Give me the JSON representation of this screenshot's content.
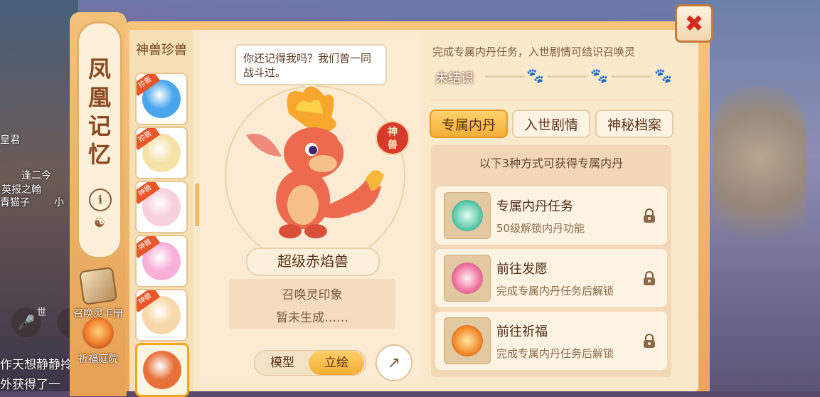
{
  "background": {
    "chat_lines": [
      "作天想静静拎",
      "外获得了一"
    ],
    "names": [
      "皇君",
      "逢二今",
      "英报之翰",
      "青猫子",
      "小"
    ],
    "world_label": "世"
  },
  "sidebar": {
    "title": "凤凰记忆",
    "info_icon": "i",
    "features": [
      {
        "label": "召唤灵卡册",
        "icon": "card-album-icon"
      },
      {
        "label": "祈福庭院",
        "icon": "lantern-icon"
      }
    ]
  },
  "list": {
    "title": "神兽珍兽",
    "items": [
      {
        "tag": "珍兽",
        "color": "#4aa6ec"
      },
      {
        "tag": "珍兽",
        "color": "#f6e2a8"
      },
      {
        "tag": "神兽",
        "color": "#f6d0dc"
      },
      {
        "tag": "神兽",
        "color": "#f8b0d8"
      },
      {
        "tag": "神兽",
        "color": "#f8d8a8"
      },
      {
        "tag": "",
        "color": "#e8703a"
      }
    ]
  },
  "display": {
    "speech": "你还记得我吗？我们曾一同战斗过。",
    "seal_text": "神兽",
    "pet_name": "超级赤焰兽",
    "imprint_title": "召唤灵印象",
    "imprint_status": "暂未生成……",
    "view_options": [
      "模型",
      "立绘"
    ],
    "active_view": "立绘"
  },
  "bond": {
    "hint": "完成专属内丹任务，入世剧情可结识召唤灵",
    "status": "未结识"
  },
  "tabs": [
    {
      "label": "专属内丹",
      "active": true
    },
    {
      "label": "入世剧情",
      "active": false
    },
    {
      "label": "神秘档案",
      "active": false
    }
  ],
  "methods": {
    "title": "以下3种方式可获得专属内丹",
    "items": [
      {
        "title": "专属内丹任务",
        "desc": "50级解锁内丹功能",
        "icon": "jade-orb-icon"
      },
      {
        "title": "前往发愿",
        "desc": "完成专属内丹任务后解锁",
        "icon": "peony-icon"
      },
      {
        "title": "前往祈福",
        "desc": "完成专属内丹任务后解锁",
        "icon": "lantern-icon"
      }
    ]
  },
  "colors": {
    "accent": "#f4ae36",
    "close": "#d22a1c",
    "panel": "#fbe9cc"
  }
}
